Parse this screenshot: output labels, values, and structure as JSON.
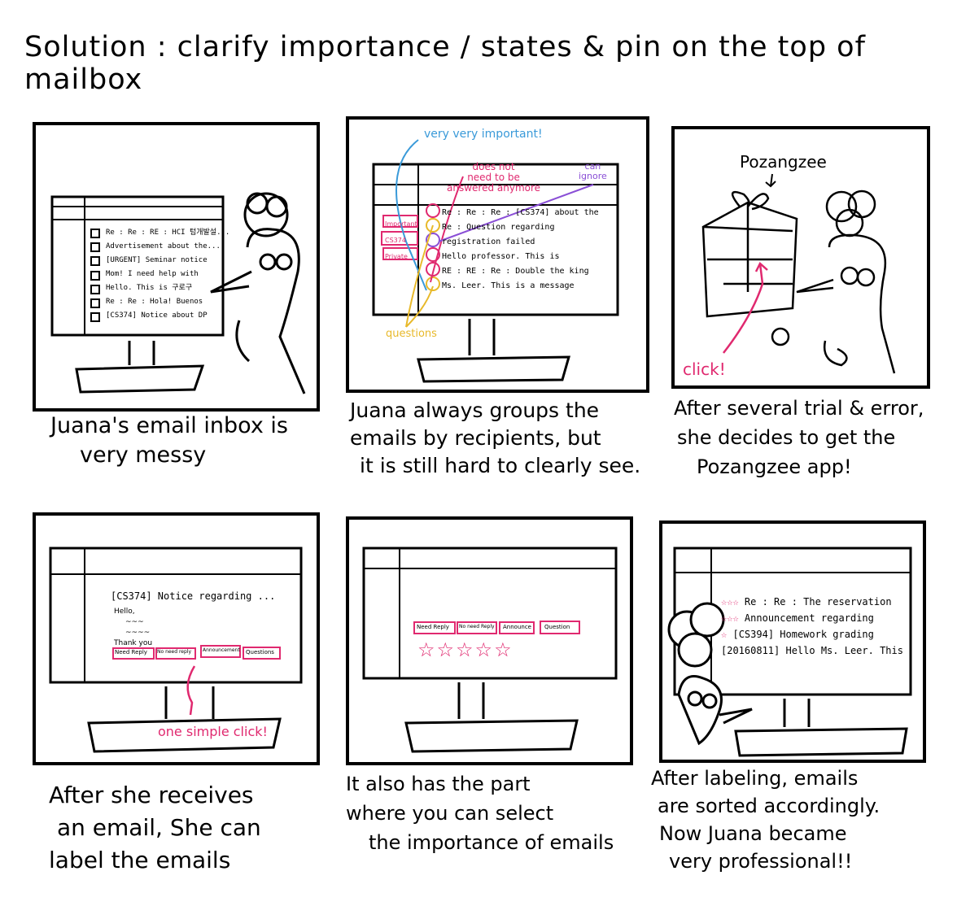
{
  "title": "Solution : clarify importance / states & pin on the top of mailbox",
  "panels": [
    {
      "caption": [
        "Juana's email inbox is",
        "very messy"
      ],
      "emails": [
        "Re : Re : RE : HCI 텀개발설...",
        "Advertisement about the...",
        "[URGENT] Seminar notice",
        "Mom! I need help with",
        "Hello. This is 구로구",
        "Re : Re : Hola! Buenos",
        "[CS374] Notice about DP"
      ]
    },
    {
      "caption": [
        "Juana always groups the",
        "emails by recipients, but",
        "it is still hard to clearly see."
      ],
      "annotations": {
        "very_important": "very very important!",
        "not_answer": [
          "does not",
          "need to be",
          "answered anymore"
        ],
        "can_ignore": [
          "can",
          "ignore"
        ],
        "questions": "questions"
      },
      "tags": [
        "Important",
        "CS374",
        "Private"
      ],
      "emails": [
        "Re : Re : Re : [CS374] about the",
        "Re : Question regarding",
        "registration failed",
        "Hello professor. This is",
        "RE : RE : Re : Double the king",
        "Ms. Leer. This is a message"
      ]
    },
    {
      "caption": [
        "After several trial & error,",
        "she decides to get the",
        "Pozangzee app!"
      ],
      "app_name": "Pozangzee",
      "click": "click!"
    },
    {
      "caption": [
        "After she receives",
        "an email, She can",
        "label the emails"
      ],
      "mail_subject": "[CS374] Notice regarding ...",
      "mail_body": [
        "Hello,",
        "~~~",
        "~~~~",
        "Thank you"
      ],
      "labels": [
        "Need Reply",
        "No need reply",
        "Announcement",
        "Questions"
      ],
      "click_note": "one simple click!"
    },
    {
      "caption": [
        "It also has the part",
        "where you can select",
        "the importance of emails"
      ],
      "labels": [
        "Need Reply",
        "No need Reply",
        "Announce",
        "Question"
      ],
      "stars": 5
    },
    {
      "caption": [
        "After labeling, emails",
        "are sorted accordingly.",
        "Now Juana became",
        "very professional!!"
      ],
      "sorted": [
        {
          "stars": "☆☆☆",
          "text": "Re : Re : The reservation"
        },
        {
          "stars": "☆☆☆",
          "text": "Announcement regarding"
        },
        {
          "stars": "☆",
          "text": "[CS394] Homework grading"
        },
        {
          "stars": "",
          "text": "[20160811] Hello Ms. Leer. This"
        }
      ]
    }
  ],
  "colors": {
    "pink": "#e0296f",
    "blue": "#3a9ad9",
    "purple": "#8a4fd6",
    "yellow": "#e8b92a",
    "ink": "#000000"
  }
}
